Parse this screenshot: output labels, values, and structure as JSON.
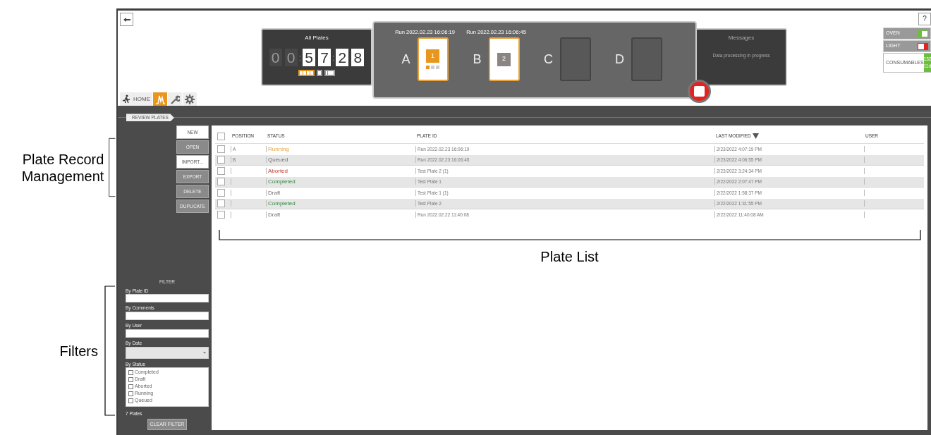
{
  "callouts": {
    "buttons": "Plate Record Management",
    "table": "Plate List",
    "filters": "Filters"
  },
  "header": {
    "timer": {
      "title": "All Plates",
      "separator": ":",
      "groups": [
        {
          "digits": [
            "0",
            "0"
          ],
          "dim": true
        },
        {
          "digits": [
            "5",
            "7"
          ],
          "dim": false
        },
        {
          "digits": [
            "2",
            "8"
          ],
          "dim": false
        }
      ],
      "modes": [
        {
          "selected": true
        },
        {
          "selected": false
        },
        {
          "selected": false
        }
      ]
    },
    "slots": [
      {
        "letter": "A",
        "run": "Run 2022.02.23 16:06:19",
        "kind": "running",
        "plate_number": "1",
        "steps": [
          {
            "done": true
          },
          {
            "done": false
          },
          {
            "done": false
          }
        ]
      },
      {
        "letter": "B",
        "run": "Run 2022.02.23 16:06:45",
        "kind": "queued",
        "plate_number": "2"
      },
      {
        "letter": "C",
        "kind": "empty"
      },
      {
        "letter": "D",
        "kind": "empty"
      }
    ],
    "messages": {
      "title": "Messages",
      "text": "Data processing in progress"
    },
    "help": "?",
    "status": [
      {
        "kind": "toggle",
        "label": "OVEN",
        "on": true
      },
      {
        "kind": "toggle",
        "label": "LIGHT",
        "on": false
      },
      {
        "kind": "counter",
        "label": "CONSUMABLES",
        "values": [
          "132",
          "11d"
        ]
      }
    ]
  },
  "nav": {
    "tabs": [
      {
        "kind": "home",
        "label": "HOME",
        "selected": false
      },
      {
        "kind": "review",
        "selected": true
      },
      {
        "kind": "tools",
        "selected": false
      },
      {
        "kind": "settings",
        "selected": false
      }
    ],
    "breadcrumb": "REVIEW PLATES"
  },
  "actions": [
    {
      "label": "NEW",
      "disabled": false
    },
    {
      "label": "OPEN",
      "disabled": true
    },
    {
      "label": "IMPORT...",
      "disabled": false
    },
    {
      "label": "EXPORT",
      "disabled": true
    },
    {
      "label": "DELETE",
      "disabled": true
    },
    {
      "label": "DUPLICATE",
      "disabled": true
    }
  ],
  "filter": {
    "title": "FILTER",
    "fields": [
      {
        "label": "By Plate ID",
        "kind": "text"
      },
      {
        "label": "By Comments",
        "kind": "text"
      },
      {
        "label": "By User",
        "kind": "text"
      },
      {
        "label": "By Date",
        "kind": "dropdown"
      }
    ],
    "status_label": "By Status",
    "statuses": [
      {
        "label": "Completed",
        "checked": false
      },
      {
        "label": "Draft",
        "checked": false
      },
      {
        "label": "Aborted",
        "checked": false
      },
      {
        "label": "Running",
        "checked": false
      },
      {
        "label": "Queued",
        "checked": false
      }
    ],
    "count": "7 Plates",
    "clear": {
      "label": "CLEAR FILTER",
      "disabled": true
    }
  },
  "table": {
    "header_checked": false,
    "columns": [
      {
        "label": "POSITION",
        "sorted": false
      },
      {
        "label": "STATUS",
        "sorted": false
      },
      {
        "label": "PLATE ID",
        "sorted": false
      },
      {
        "label": "LAST MODIFIED",
        "sorted": true
      },
      {
        "label": "USER",
        "sorted": false
      }
    ],
    "rows": [
      {
        "checked": false,
        "position": "A",
        "status": "Running",
        "kind": "running",
        "plate_id": "Run 2022.02.23 16:06:19",
        "last_modified": "2/23/2022 4:07:19 PM"
      },
      {
        "checked": false,
        "position": "B",
        "status": "Queued",
        "kind": "queued",
        "plate_id": "Run 2022.02.23 16:06:45",
        "last_modified": "2/23/2022 4:06:55 PM"
      },
      {
        "checked": false,
        "position": "",
        "status": "Aborted",
        "kind": "aborted",
        "plate_id": "Test Plate 2 (1)",
        "last_modified": "2/23/2022 3:24:34 PM"
      },
      {
        "checked": false,
        "position": "",
        "status": "Completed",
        "kind": "completed",
        "plate_id": "Test Plate 1",
        "last_modified": "2/22/2022 2:07:47 PM"
      },
      {
        "checked": false,
        "position": "",
        "status": "Draft",
        "kind": "draft",
        "plate_id": "Test Plate 1 (1)",
        "last_modified": "2/22/2022 1:58:37 PM"
      },
      {
        "checked": false,
        "position": "",
        "status": "Completed",
        "kind": "completed",
        "plate_id": "Test Plate 2",
        "last_modified": "2/22/2022 1:31:55 PM"
      },
      {
        "checked": false,
        "position": "",
        "status": "Draft",
        "kind": "draft",
        "plate_id": "Run 2022.02.22 11:40:08",
        "last_modified": "2/22/2022 11:40:08 AM"
      }
    ]
  }
}
